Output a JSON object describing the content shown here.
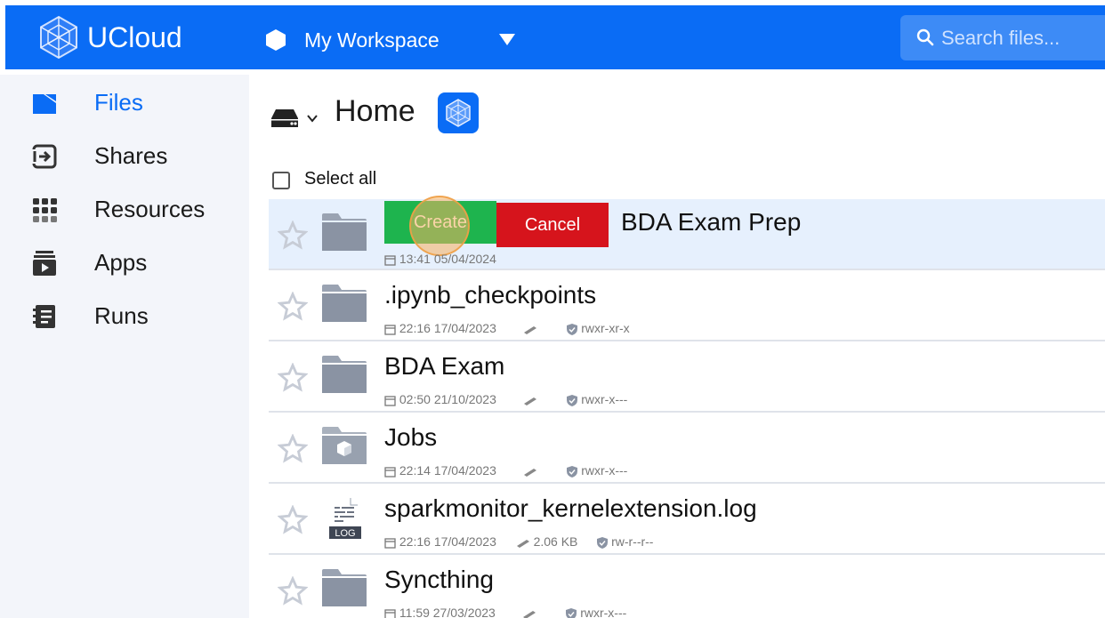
{
  "app": {
    "name": "UCloud",
    "logo_icon": "ucloud-logo-icon"
  },
  "workspace": {
    "label": "My Workspace",
    "icon": "workspace-hexagon-icon",
    "caret_icon": "caret-down-icon"
  },
  "search": {
    "placeholder": "Search files...",
    "icon": "search-icon"
  },
  "sidebar": {
    "items": [
      {
        "label": "Files",
        "icon": "files-icon",
        "active": true
      },
      {
        "label": "Shares",
        "icon": "shares-icon",
        "active": false
      },
      {
        "label": "Resources",
        "icon": "resources-grid-icon",
        "active": false
      },
      {
        "label": "Apps",
        "icon": "apps-icon",
        "active": false
      },
      {
        "label": "Runs",
        "icon": "runs-icon",
        "active": false
      }
    ]
  },
  "main": {
    "title": "Home",
    "select_all_label": "Select all",
    "editing_row": {
      "create_label": "Create",
      "cancel_label": "Cancel",
      "name": "BDA Exam Prep",
      "date": "13:41 05/04/2024"
    },
    "files": [
      {
        "name": ".ipynb_checkpoints",
        "date": "22:16 17/04/2023",
        "size": "",
        "perms": "rwxr-xr-x",
        "icon": "folder-icon"
      },
      {
        "name": "BDA Exam",
        "date": "02:50 21/10/2023",
        "size": "",
        "perms": "rwxr-x---",
        "icon": "folder-icon"
      },
      {
        "name": "Jobs",
        "date": "22:14 17/04/2023",
        "size": "",
        "perms": "rwxr-x---",
        "icon": "jobs-folder-icon"
      },
      {
        "name": "sparkmonitor_kernelextension.log",
        "date": "22:16 17/04/2023",
        "size": "2.06 KB",
        "perms": "rw-r--r--",
        "icon": "log-file-icon"
      },
      {
        "name": "Syncthing",
        "date": "11:59 27/03/2023",
        "size": "",
        "perms": "rwxr-x---",
        "icon": "folder-icon"
      }
    ],
    "log_badge": "LOG"
  },
  "colors": {
    "brand": "#0a6cf5",
    "create": "#1eb44e",
    "cancel": "#d6141c",
    "selected_row": "#e6f0fd"
  }
}
